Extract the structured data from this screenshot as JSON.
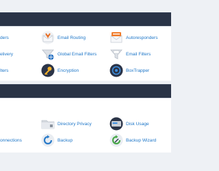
{
  "email": {
    "items": [
      {
        "label": "ders"
      },
      {
        "label": "Email Routing",
        "icon": "email-routing-icon"
      },
      {
        "label": "Autoresponders",
        "icon": "autoresponders-icon"
      },
      {
        "label": "elivery"
      },
      {
        "label": "Global Email Filters",
        "icon": "global-email-filters-icon"
      },
      {
        "label": "Email Filters",
        "icon": "email-filters-icon"
      },
      {
        "label": "lters"
      },
      {
        "label": "Encryption",
        "icon": "encryption-key-icon"
      },
      {
        "label": "BoxTrapper",
        "icon": "boxtrapper-icon"
      }
    ]
  },
  "files": {
    "items": [
      {
        "label": "Directory Privacy",
        "icon": "directory-privacy-icon"
      },
      {
        "label": "Disk Usage",
        "icon": "disk-usage-icon"
      },
      {
        "label": "onnections"
      },
      {
        "label": "Backup",
        "icon": "backup-icon"
      },
      {
        "label": "Backup Wizard",
        "icon": "backup-wizard-icon"
      }
    ]
  },
  "colors": {
    "link": "#1d76c8",
    "header": "#2a3447",
    "background": "#eef1f5"
  }
}
